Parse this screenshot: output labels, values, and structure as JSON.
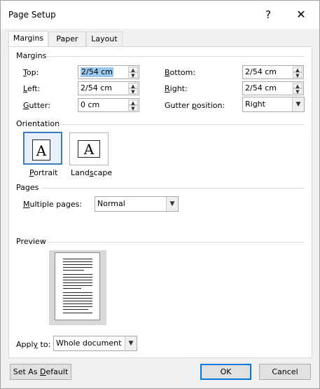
{
  "window": {
    "title": "Page Setup",
    "help_glyph": "?",
    "close_glyph": "✕"
  },
  "tabs": [
    {
      "label": "Margins"
    },
    {
      "label": "Paper"
    },
    {
      "label": "Layout"
    }
  ],
  "margins": {
    "section_label": "Margins",
    "top_label_u": "T",
    "top_label_rest": "op:",
    "top_value": "2/54 cm",
    "bottom_label_u": "B",
    "bottom_label_rest": "ottom:",
    "bottom_value": "2/54 cm",
    "left_label_u": "L",
    "left_label_rest": "eft:",
    "left_value": "2/54 cm",
    "right_label_u": "R",
    "right_label_rest": "ight:",
    "right_value": "2/54 cm",
    "gutter_label_u": "G",
    "gutter_label_rest": "utter:",
    "gutter_value": "0 cm",
    "gutter_pos_label_pre": "Gutter ",
    "gutter_pos_label_u": "p",
    "gutter_pos_label_rest": "osition:",
    "gutter_pos_value": "Right"
  },
  "orientation": {
    "section_label": "Orientation",
    "icon_letter": "A",
    "portrait_label_u": "P",
    "portrait_label_rest": "ortrait",
    "landscape_label_u": "s",
    "landscape_label_pre": "Land",
    "landscape_label_rest": "cape"
  },
  "pages": {
    "section_label": "Pages",
    "multiple_label_u": "M",
    "multiple_label_rest": "ultiple pages:",
    "multiple_value": "Normal"
  },
  "preview": {
    "section_label": "Preview"
  },
  "apply": {
    "label_pre": "Appl",
    "label_u": "y",
    "label_rest": " to:",
    "value": "Whole document"
  },
  "buttons": {
    "set_default_pre": "Set As ",
    "set_default_u": "D",
    "set_default_rest": "efault",
    "ok": "OK",
    "cancel": "Cancel"
  },
  "colors": {
    "selection": "#99c9ef",
    "accent": "#0078d7"
  }
}
